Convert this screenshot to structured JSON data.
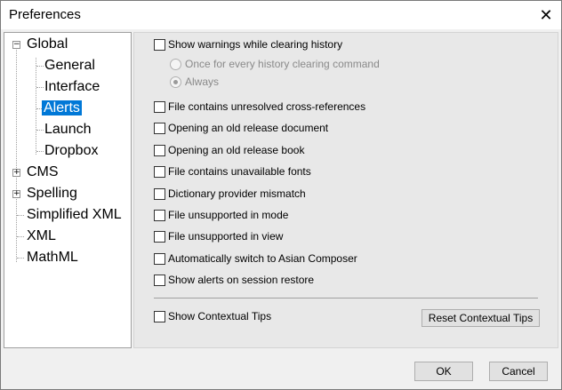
{
  "window": {
    "title": "Preferences"
  },
  "icons": {
    "close": "close-icon",
    "expand": "plus-icon",
    "collapse": "minus-icon"
  },
  "tree": {
    "items": [
      {
        "label": "Global",
        "expander": "⊟"
      },
      {
        "label": "General"
      },
      {
        "label": "Interface"
      },
      {
        "label": "Alerts",
        "selected": true
      },
      {
        "label": "Launch"
      },
      {
        "label": "Dropbox"
      },
      {
        "label": "CMS",
        "expander": "⊞"
      },
      {
        "label": "Spelling",
        "expander": "⊞"
      },
      {
        "label": "Simplified XML"
      },
      {
        "label": "XML"
      },
      {
        "label": "MathML"
      }
    ]
  },
  "alerts": {
    "show_warnings": "Show warnings while clearing history",
    "radio_once": "Once for every history clearing command",
    "radio_always": "Always",
    "options": [
      "File contains unresolved cross-references",
      "Opening an old release document",
      "Opening an old release book",
      "File contains unavailable fonts",
      "Dictionary provider mismatch",
      "File unsupported in mode",
      "File unsupported in view",
      "Automatically switch to Asian Composer",
      "Show alerts on session restore"
    ],
    "contextual_tips": "Show Contextual Tips",
    "reset_tips": "Reset Contextual Tips"
  },
  "footer": {
    "ok": "OK",
    "cancel": "Cancel"
  }
}
